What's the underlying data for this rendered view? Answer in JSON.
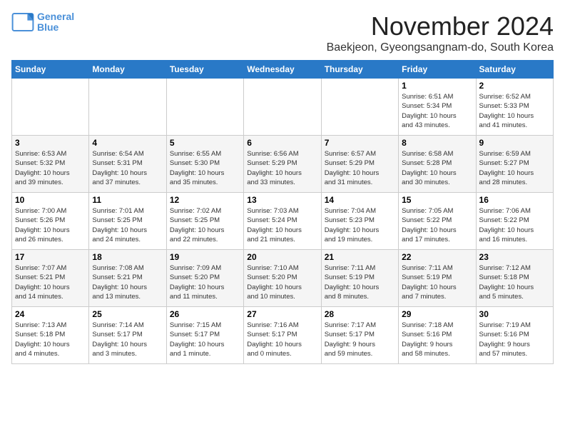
{
  "logo": {
    "line1": "General",
    "line2": "Blue"
  },
  "title": "November 2024",
  "subtitle": "Baekjeon, Gyeongsangnam-do, South Korea",
  "headers": [
    "Sunday",
    "Monday",
    "Tuesday",
    "Wednesday",
    "Thursday",
    "Friday",
    "Saturday"
  ],
  "weeks": [
    [
      {
        "day": "",
        "info": ""
      },
      {
        "day": "",
        "info": ""
      },
      {
        "day": "",
        "info": ""
      },
      {
        "day": "",
        "info": ""
      },
      {
        "day": "",
        "info": ""
      },
      {
        "day": "1",
        "info": "Sunrise: 6:51 AM\nSunset: 5:34 PM\nDaylight: 10 hours\nand 43 minutes."
      },
      {
        "day": "2",
        "info": "Sunrise: 6:52 AM\nSunset: 5:33 PM\nDaylight: 10 hours\nand 41 minutes."
      }
    ],
    [
      {
        "day": "3",
        "info": "Sunrise: 6:53 AM\nSunset: 5:32 PM\nDaylight: 10 hours\nand 39 minutes."
      },
      {
        "day": "4",
        "info": "Sunrise: 6:54 AM\nSunset: 5:31 PM\nDaylight: 10 hours\nand 37 minutes."
      },
      {
        "day": "5",
        "info": "Sunrise: 6:55 AM\nSunset: 5:30 PM\nDaylight: 10 hours\nand 35 minutes."
      },
      {
        "day": "6",
        "info": "Sunrise: 6:56 AM\nSunset: 5:29 PM\nDaylight: 10 hours\nand 33 minutes."
      },
      {
        "day": "7",
        "info": "Sunrise: 6:57 AM\nSunset: 5:29 PM\nDaylight: 10 hours\nand 31 minutes."
      },
      {
        "day": "8",
        "info": "Sunrise: 6:58 AM\nSunset: 5:28 PM\nDaylight: 10 hours\nand 30 minutes."
      },
      {
        "day": "9",
        "info": "Sunrise: 6:59 AM\nSunset: 5:27 PM\nDaylight: 10 hours\nand 28 minutes."
      }
    ],
    [
      {
        "day": "10",
        "info": "Sunrise: 7:00 AM\nSunset: 5:26 PM\nDaylight: 10 hours\nand 26 minutes."
      },
      {
        "day": "11",
        "info": "Sunrise: 7:01 AM\nSunset: 5:25 PM\nDaylight: 10 hours\nand 24 minutes."
      },
      {
        "day": "12",
        "info": "Sunrise: 7:02 AM\nSunset: 5:25 PM\nDaylight: 10 hours\nand 22 minutes."
      },
      {
        "day": "13",
        "info": "Sunrise: 7:03 AM\nSunset: 5:24 PM\nDaylight: 10 hours\nand 21 minutes."
      },
      {
        "day": "14",
        "info": "Sunrise: 7:04 AM\nSunset: 5:23 PM\nDaylight: 10 hours\nand 19 minutes."
      },
      {
        "day": "15",
        "info": "Sunrise: 7:05 AM\nSunset: 5:22 PM\nDaylight: 10 hours\nand 17 minutes."
      },
      {
        "day": "16",
        "info": "Sunrise: 7:06 AM\nSunset: 5:22 PM\nDaylight: 10 hours\nand 16 minutes."
      }
    ],
    [
      {
        "day": "17",
        "info": "Sunrise: 7:07 AM\nSunset: 5:21 PM\nDaylight: 10 hours\nand 14 minutes."
      },
      {
        "day": "18",
        "info": "Sunrise: 7:08 AM\nSunset: 5:21 PM\nDaylight: 10 hours\nand 13 minutes."
      },
      {
        "day": "19",
        "info": "Sunrise: 7:09 AM\nSunset: 5:20 PM\nDaylight: 10 hours\nand 11 minutes."
      },
      {
        "day": "20",
        "info": "Sunrise: 7:10 AM\nSunset: 5:20 PM\nDaylight: 10 hours\nand 10 minutes."
      },
      {
        "day": "21",
        "info": "Sunrise: 7:11 AM\nSunset: 5:19 PM\nDaylight: 10 hours\nand 8 minutes."
      },
      {
        "day": "22",
        "info": "Sunrise: 7:11 AM\nSunset: 5:19 PM\nDaylight: 10 hours\nand 7 minutes."
      },
      {
        "day": "23",
        "info": "Sunrise: 7:12 AM\nSunset: 5:18 PM\nDaylight: 10 hours\nand 5 minutes."
      }
    ],
    [
      {
        "day": "24",
        "info": "Sunrise: 7:13 AM\nSunset: 5:18 PM\nDaylight: 10 hours\nand 4 minutes."
      },
      {
        "day": "25",
        "info": "Sunrise: 7:14 AM\nSunset: 5:17 PM\nDaylight: 10 hours\nand 3 minutes."
      },
      {
        "day": "26",
        "info": "Sunrise: 7:15 AM\nSunset: 5:17 PM\nDaylight: 10 hours\nand 1 minute."
      },
      {
        "day": "27",
        "info": "Sunrise: 7:16 AM\nSunset: 5:17 PM\nDaylight: 10 hours\nand 0 minutes."
      },
      {
        "day": "28",
        "info": "Sunrise: 7:17 AM\nSunset: 5:17 PM\nDaylight: 9 hours\nand 59 minutes."
      },
      {
        "day": "29",
        "info": "Sunrise: 7:18 AM\nSunset: 5:16 PM\nDaylight: 9 hours\nand 58 minutes."
      },
      {
        "day": "30",
        "info": "Sunrise: 7:19 AM\nSunset: 5:16 PM\nDaylight: 9 hours\nand 57 minutes."
      }
    ]
  ]
}
